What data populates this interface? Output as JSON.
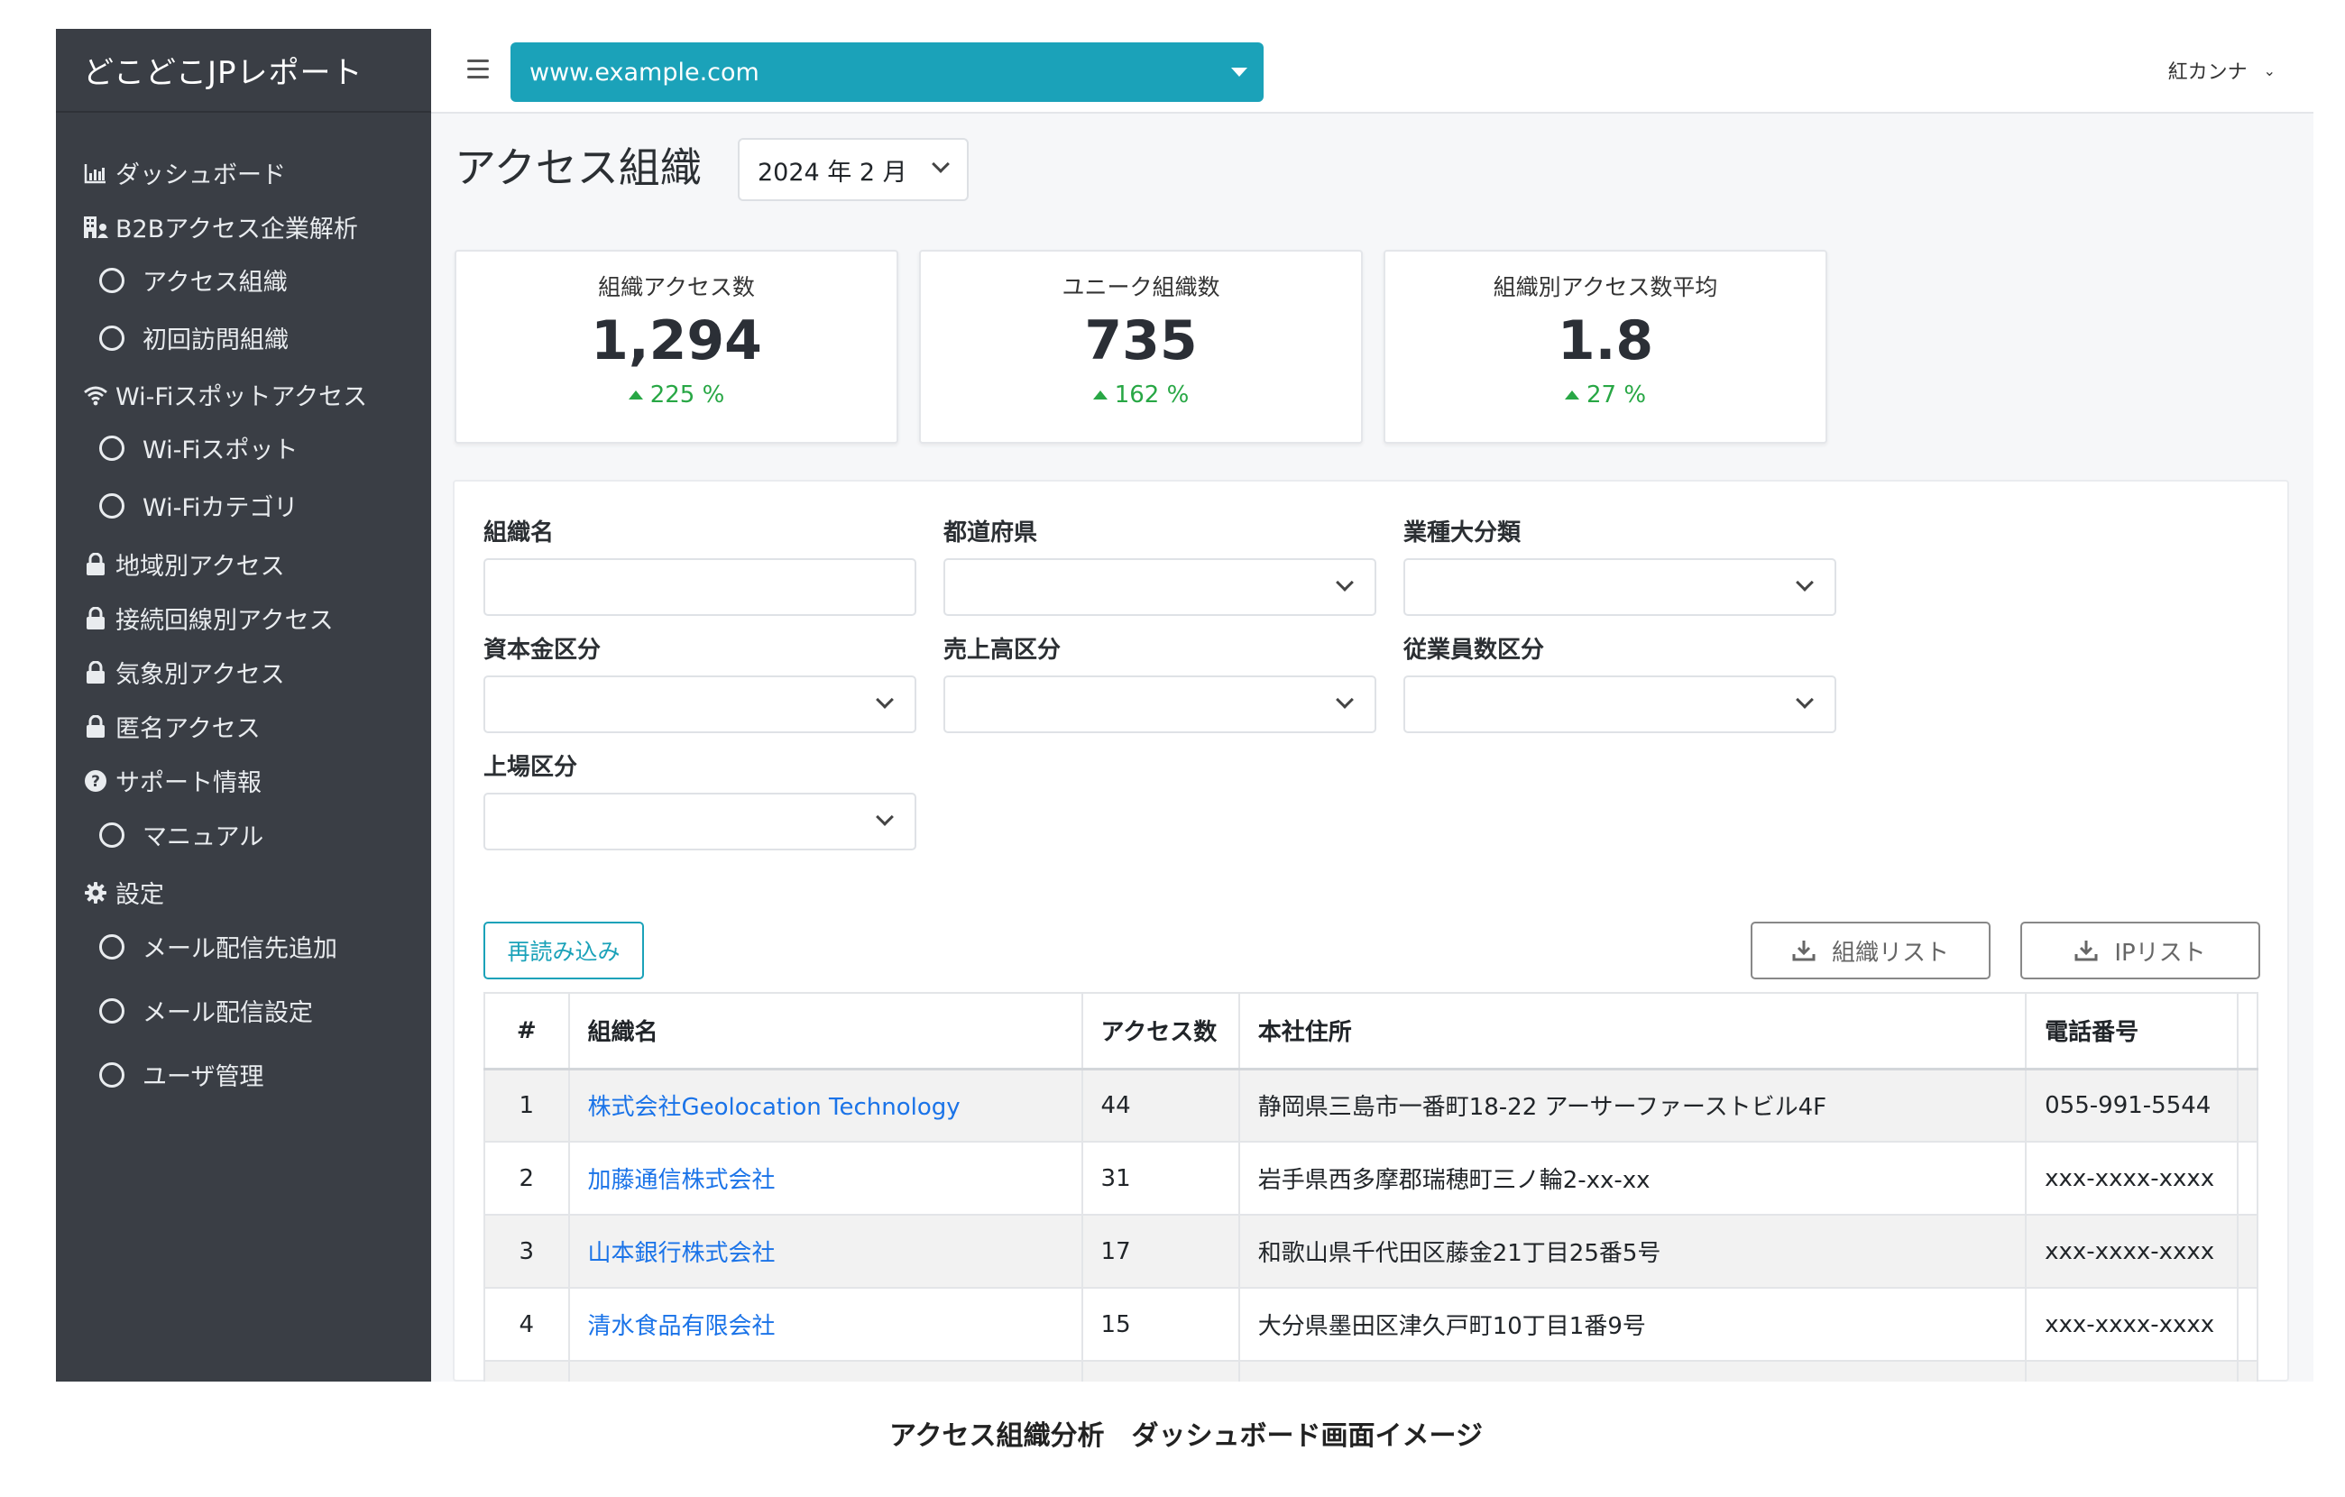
{
  "app": {
    "brand": "どこどこJPレポート"
  },
  "sidebar": {
    "items": [
      {
        "label": "ダッシュボード",
        "icon": "bar-chart-icon",
        "type": "section"
      },
      {
        "label": "B2Bアクセス企業解析",
        "icon": "building-icon",
        "type": "section"
      },
      {
        "label": "アクセス組織",
        "type": "sub"
      },
      {
        "label": "初回訪問組織",
        "type": "sub"
      },
      {
        "label": "Wi-Fiスポットアクセス",
        "icon": "wifi-icon",
        "type": "section"
      },
      {
        "label": "Wi-Fiスポット",
        "type": "sub"
      },
      {
        "label": "Wi-Fiカテゴリ",
        "type": "sub"
      },
      {
        "label": "地域別アクセス",
        "icon": "lock-icon",
        "type": "section"
      },
      {
        "label": "接続回線別アクセス",
        "icon": "lock-icon",
        "type": "section"
      },
      {
        "label": "気象別アクセス",
        "icon": "lock-icon",
        "type": "section"
      },
      {
        "label": "匿名アクセス",
        "icon": "lock-icon",
        "type": "section"
      },
      {
        "label": "サポート情報",
        "icon": "question-icon",
        "type": "section"
      },
      {
        "label": "マニュアル",
        "type": "sub"
      },
      {
        "label": "設定",
        "icon": "gear-icon",
        "type": "section"
      },
      {
        "label": "メール配信先追加",
        "type": "sub"
      },
      {
        "label": "メール配信設定",
        "type": "sub"
      },
      {
        "label": "ユーザ管理",
        "type": "sub"
      }
    ]
  },
  "topbar": {
    "site": "www.example.com",
    "user": "紅カンナ"
  },
  "page": {
    "title": "アクセス組織",
    "month": "2024 年 2 月"
  },
  "stats": [
    {
      "label": "組織アクセス数",
      "value": "1,294",
      "change": "225 %"
    },
    {
      "label": "ユニーク組織数",
      "value": "735",
      "change": "162 %"
    },
    {
      "label": "組織別アクセス数平均",
      "value": "1.8",
      "change": "27 %"
    }
  ],
  "filters": {
    "org_name": "組織名",
    "prefecture": "都道府県",
    "industry": "業種大分類",
    "capital": "資本金区分",
    "sales": "売上高区分",
    "employees": "従業員数区分",
    "listing": "上場区分"
  },
  "actions": {
    "reload": "再読み込み",
    "org_list": "組織リスト",
    "ip_list": "IPリスト"
  },
  "table": {
    "headers": [
      "#",
      "組織名",
      "アクセス数",
      "本社住所",
      "電話番号"
    ],
    "rows": [
      [
        "1",
        "株式会社Geolocation Technology",
        "44",
        "静岡県三島市一番町18-22 アーサーファーストビル4F",
        "055-991-5544"
      ],
      [
        "2",
        "加藤通信株式会社",
        "31",
        "岩手県西多摩郡瑞穂町三ノ輪2-xx-xx",
        "xxx-xxxx-xxxx"
      ],
      [
        "3",
        "山本銀行株式会社",
        "17",
        "和歌山県千代田区藤金21丁目25番5号",
        "xxx-xxxx-xxxx"
      ],
      [
        "4",
        "清水食品有限会社",
        "15",
        "大分県墨田区津久戸町10丁目1番9号",
        "xxx-xxxx-xxxx"
      ]
    ]
  },
  "caption": "アクセス組織分析　ダッシュボード画面イメージ"
}
